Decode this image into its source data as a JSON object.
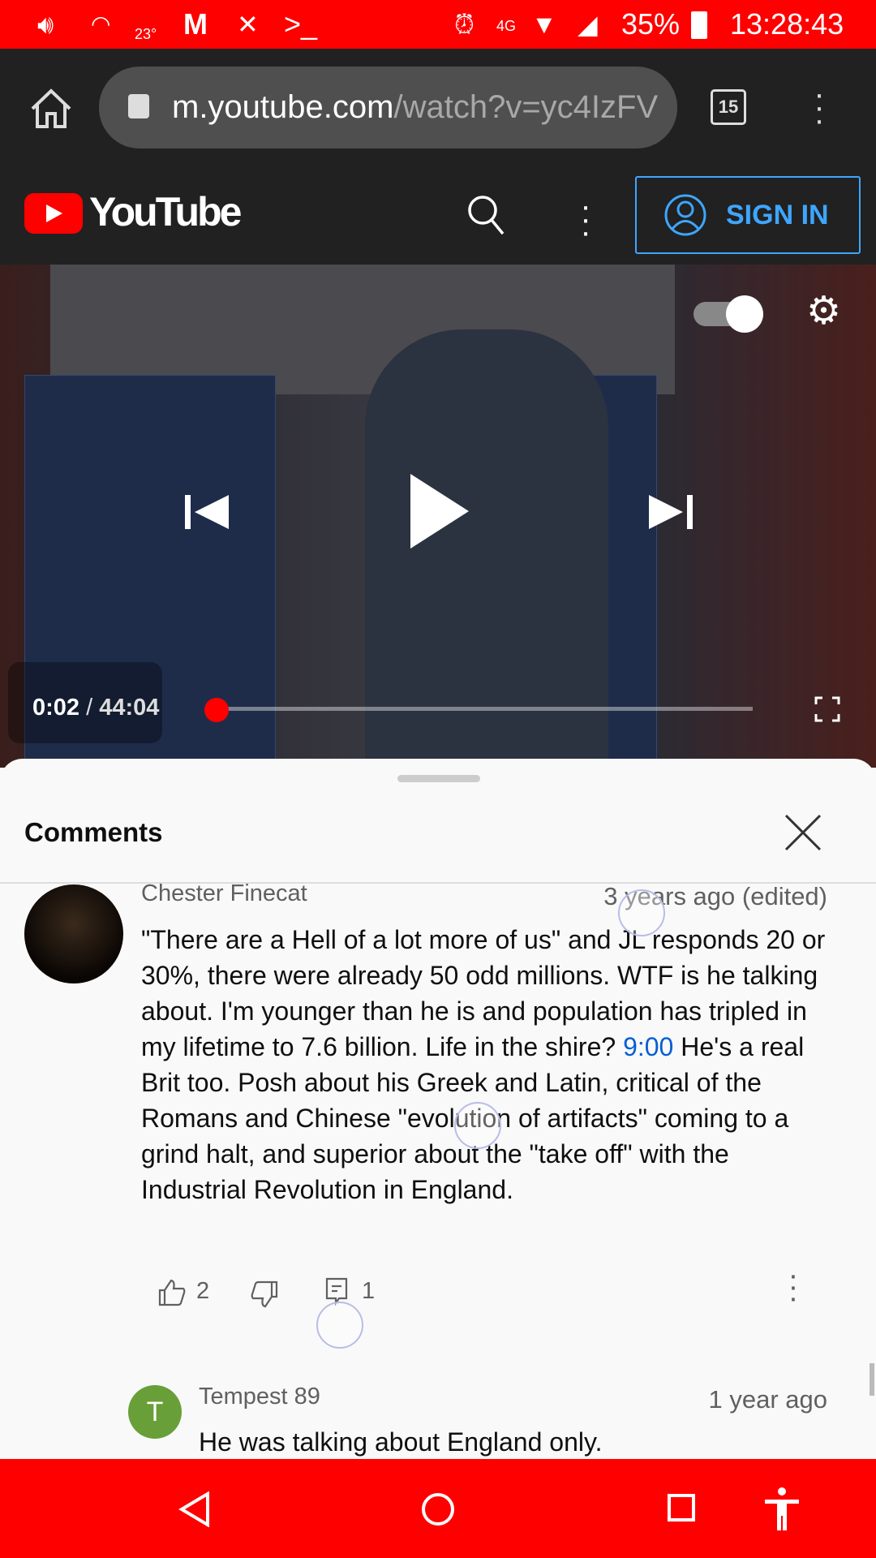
{
  "status_bar": {
    "temperature": "23°",
    "network": "4G",
    "battery": "35%",
    "time": "13:28:43"
  },
  "browser": {
    "url_domain": "m.youtube.com",
    "url_path": "/watch?v=yc4IzFV",
    "tab_count": "15"
  },
  "youtube_header": {
    "logo_text": "YouTube",
    "sign_in_label": "SIGN IN"
  },
  "player": {
    "current_time": "0:02",
    "separator": "/",
    "duration": "44:04",
    "progress_fraction": 0.0008
  },
  "comments_panel": {
    "title": "Comments",
    "comment": {
      "author": "Chester Finecat",
      "time": "3 years ago (edited)",
      "text_before_link": "\"There are a Hell of a lot more of us\" and JL responds 20 or 30%, there were already 50 odd millions. WTF is he talking about. I'm younger than he is and population has tripled in my lifetime to 7.6 billion. Life in the shire? ",
      "timestamp_link": "9:00",
      "text_after_link": " He's a real Brit too. Posh about his Greek and Latin, critical of the Romans and Chinese \"evolution of artifacts\" coming to a grind halt, and superior about the \"take off\" with the Industrial Revolution in England.",
      "likes": "2",
      "replies": "1"
    },
    "reply": {
      "avatar_letter": "T",
      "author": "Tempest 89",
      "time": "1 year ago",
      "text": "He was talking about England only.",
      "avatar_color": "#689f38"
    }
  }
}
